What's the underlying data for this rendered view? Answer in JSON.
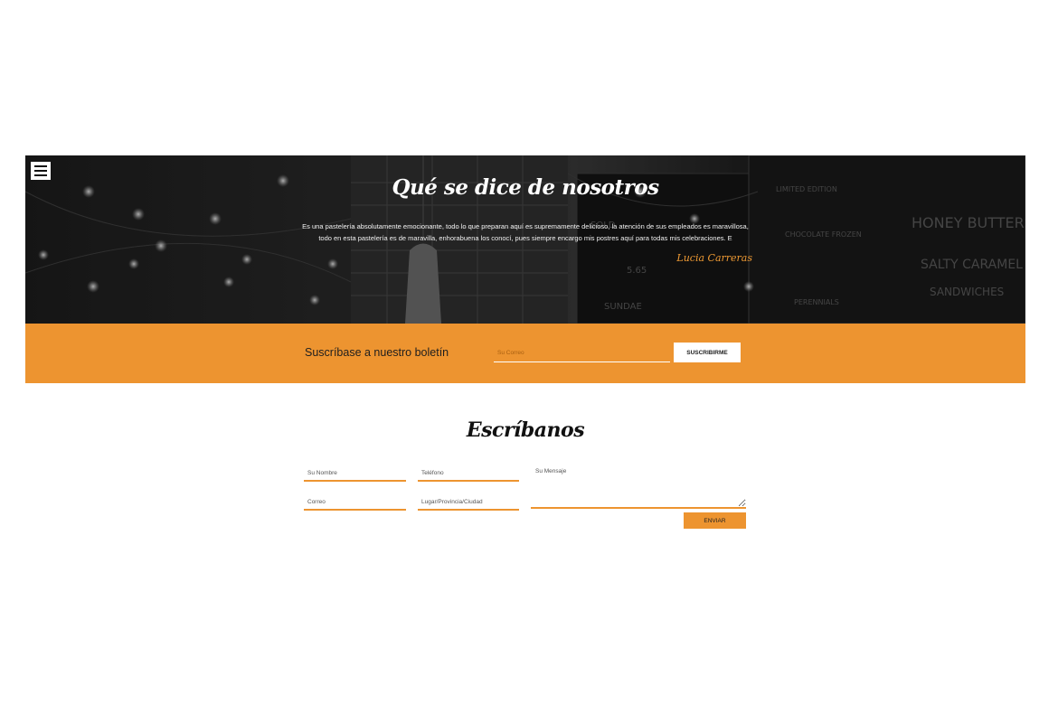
{
  "menu": {
    "icon": "hamburger-menu-icon"
  },
  "testimonial": {
    "title": "Qué se dice de nosotros",
    "quote": "Es una pastelería absolutamente emocionante, todo lo que preparan aquí es supremamente delicioso, la atención de sus empleados es maravillosa, todo en esta pastelería es de maravilla, enhorabuena los conocí, pues siempre encargo mis postres aquí para todas mis celebraciones. E",
    "author": "Lucia Carreras"
  },
  "newsletter": {
    "label": "Suscríbase a nuestro boletín",
    "email_placeholder": "Su Correo",
    "subscribe_label": "SUSCRIBIRME"
  },
  "contact": {
    "title": "Escríbanos",
    "name_placeholder": "Su Nombre",
    "phone_placeholder": "Teléfono",
    "message_placeholder": "Su Mensaje",
    "email_placeholder": "Correo",
    "place_placeholder": "Lugar/Provincia/Ciudad",
    "send_label": "ENVIAR"
  },
  "colors": {
    "accent": "#ed9430",
    "author": "#ee9a34",
    "hero_bg": "#141414",
    "white": "#ffffff"
  }
}
